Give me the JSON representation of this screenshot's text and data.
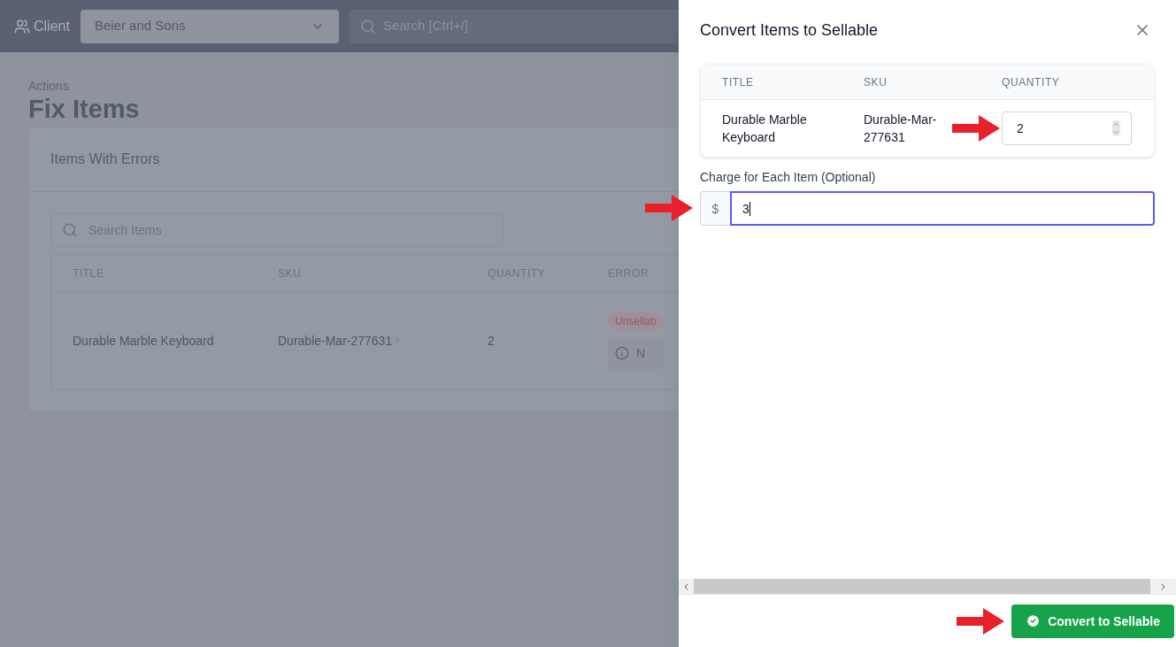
{
  "header": {
    "client_label": "Client",
    "client_select": "Beier and Sons",
    "search_placeholder": "Search [Ctrl+/]"
  },
  "page": {
    "breadcrumb": "Actions",
    "title": "Fix Items",
    "card": {
      "title": "Items With Errors",
      "search_placeholder": "Search Items",
      "columns": [
        "TITLE",
        "SKU",
        "QUANTITY",
        "ERROR"
      ],
      "rows": [
        {
          "title": "Durable Marble Keyboard",
          "sku": "Durable-Mar-277631",
          "quantity": "2",
          "error_badge": "Unsellab",
          "error_note": "N"
        }
      ]
    }
  },
  "dialog": {
    "title": "Convert Items to Sellable",
    "table": {
      "columns": [
        "TITLE",
        "SKU",
        "QUANTITY"
      ],
      "rows": [
        {
          "title": "Durable Marble Keyboard",
          "sku": "Durable-Mar-277631",
          "quantity": "2"
        }
      ]
    },
    "charge": {
      "label": "Charge for Each Item (Optional)",
      "prefix": "$",
      "value": "3"
    },
    "button": "Convert to Sellable"
  }
}
